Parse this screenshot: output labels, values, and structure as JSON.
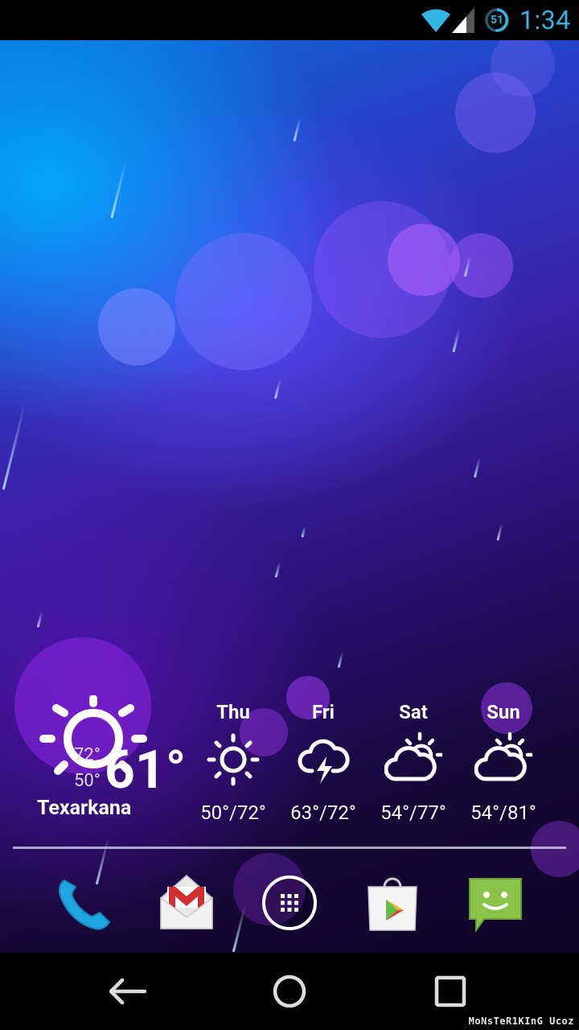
{
  "status_bar": {
    "time": "1:34",
    "battery_level": "51",
    "wifi_icon": "wifi-full-icon",
    "signal_icon": "cell-signal-icon",
    "accent_color": "#33b5e5"
  },
  "weather": {
    "current_icon": "sun-icon",
    "current_temp": "61°",
    "high": "72°",
    "low": "50°",
    "city": "Texarkana",
    "forecast": [
      {
        "day": "Thu",
        "icon": "sun-icon",
        "temps": "50°/72°"
      },
      {
        "day": "Fri",
        "icon": "thunderstorm-icon",
        "temps": "63°/72°"
      },
      {
        "day": "Sat",
        "icon": "partly-cloudy-icon",
        "temps": "54°/77°"
      },
      {
        "day": "Sun",
        "icon": "partly-cloudy-icon",
        "temps": "54°/81°"
      }
    ]
  },
  "dock": {
    "apps": [
      {
        "icon": "phone-icon"
      },
      {
        "icon": "gmail-icon"
      },
      {
        "icon": "all-apps-icon"
      },
      {
        "icon": "play-store-icon"
      },
      {
        "icon": "messaging-icon"
      }
    ]
  },
  "nav_bar": {
    "buttons": [
      "back-icon",
      "home-icon",
      "recents-icon"
    ]
  },
  "watermark": "MoNsTeR1KInG Ucoz"
}
